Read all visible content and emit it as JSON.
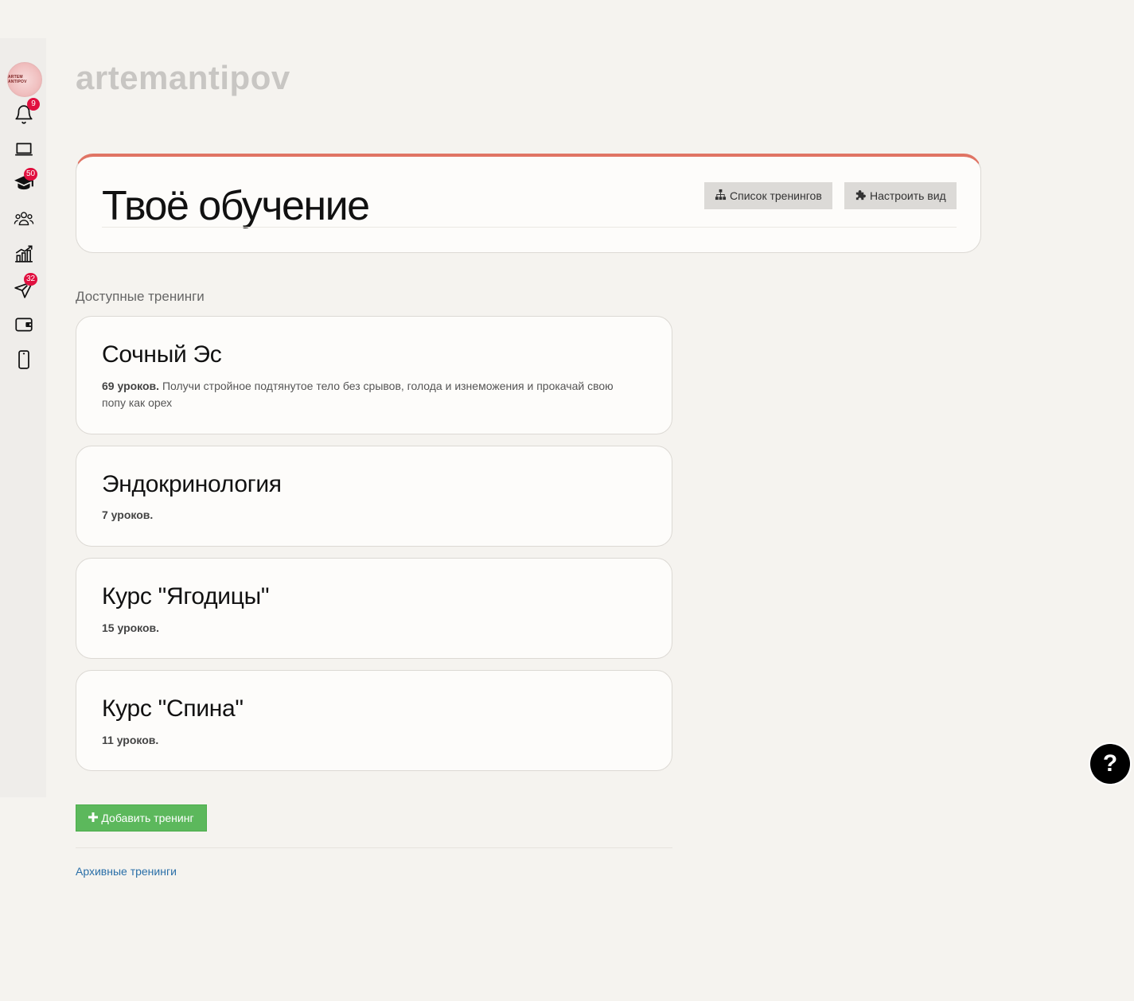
{
  "brand": "artemantipov",
  "sidebar": {
    "avatar_text": "ARTEM ANTIPOV",
    "items": [
      {
        "icon": "bell-icon",
        "badge": "9"
      },
      {
        "icon": "laptop-icon",
        "badge": ""
      },
      {
        "icon": "graduation-cap-icon",
        "badge": "50"
      },
      {
        "icon": "users-icon",
        "badge": ""
      },
      {
        "icon": "chart-icon",
        "badge": ""
      },
      {
        "icon": "send-icon",
        "badge": "32"
      },
      {
        "icon": "wallet-icon",
        "badge": ""
      },
      {
        "icon": "phone-icon",
        "badge": ""
      }
    ]
  },
  "header": {
    "title": "Твоё обучение",
    "list_button": "Список тренингов",
    "customize_button": "Настроить вид"
  },
  "section_label": "Доступные тренинги",
  "courses": [
    {
      "title": "Сочный Эс",
      "lessons": "69 уроков.",
      "description": "Получи стройное подтянутое тело без срывов, голода и изнеможения и прокачай свою попу как орех"
    },
    {
      "title": "Эндокринология",
      "lessons": "7 уроков.",
      "description": ""
    },
    {
      "title": "Курс \"Ягодицы\"",
      "lessons": "15 уроков.",
      "description": ""
    },
    {
      "title": "Курс \"Спина\"",
      "lessons": "11 уроков.",
      "description": ""
    }
  ],
  "add_button": "Добавить тренинг",
  "archive_link": "Архивные тренинги",
  "help_label": "?",
  "colors": {
    "accent": "#e07464",
    "badge": "#e0103f",
    "add_button": "#5cb85c",
    "link": "#2a6fa8"
  }
}
